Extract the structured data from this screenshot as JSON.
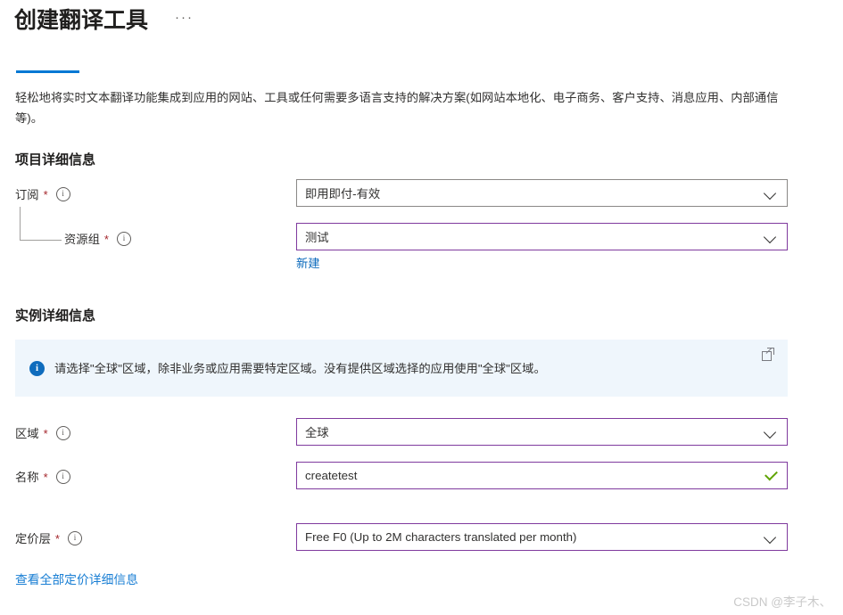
{
  "header": {
    "title": "创建翻译工具",
    "more_label": "···"
  },
  "description": "轻松地将实时文本翻译功能集成到应用的网站、工具或任何需要多语言支持的解决方案(如网站本地化、电子商务、客户支持、消息应用、内部通信等)。",
  "sections": {
    "project_details": {
      "title": "项目详细信息",
      "subscription": {
        "label": "订阅",
        "required_marker": "*",
        "info_glyph": "i",
        "value": "即用即付-有效"
      },
      "resource_group": {
        "label": "资源组",
        "required_marker": "*",
        "info_glyph": "i",
        "value": "测试",
        "new_link": "新建"
      }
    },
    "instance_details": {
      "title": "实例详细信息",
      "banner": {
        "icon_glyph": "i",
        "text": "请选择\"全球\"区域，除非业务或应用需要特定区域。没有提供区域选择的应用使用\"全球\"区域。"
      },
      "region": {
        "label": "区域",
        "required_marker": "*",
        "info_glyph": "i",
        "value": "全球"
      },
      "name": {
        "label": "名称",
        "required_marker": "*",
        "info_glyph": "i",
        "value": "createtest"
      },
      "pricing_tier": {
        "label": "定价层",
        "required_marker": "*",
        "info_glyph": "i",
        "value": "Free F0 (Up to 2M characters translated per month)"
      },
      "pricing_details_link": "查看全部定价详细信息"
    }
  },
  "watermark": "CSDN @李子木、",
  "colors": {
    "accent_blue": "#0078d4",
    "link_blue": "#0f6cbd",
    "focus_purple": "#7f3a9e",
    "required_red": "#a4262c",
    "valid_green": "#5fa300",
    "banner_bg": "#eff6fc"
  }
}
